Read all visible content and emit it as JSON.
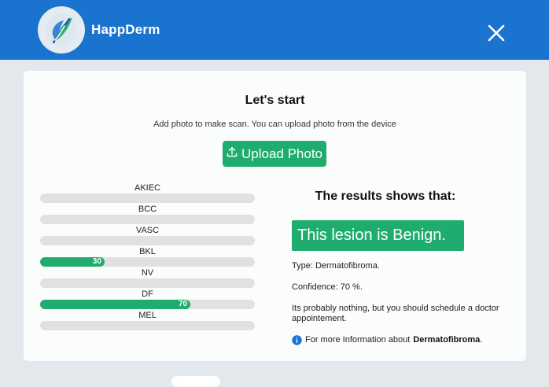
{
  "header": {
    "app_name": "HappDerm",
    "logo_icon": "leaf-logo-icon",
    "close_icon": "close-icon",
    "background": "#1a73cf"
  },
  "main": {
    "title": "Let's start",
    "subtitle": "Add photo to make scan. You can upload photo from the device",
    "upload_label": "Upload Photo",
    "upload_icon": "upload-icon",
    "accent": "#1fad6f"
  },
  "classes": [
    {
      "label": "AKIEC",
      "value": 0,
      "value_label": ""
    },
    {
      "label": "BCC",
      "value": 0,
      "value_label": ""
    },
    {
      "label": "VASC",
      "value": 0,
      "value_label": ""
    },
    {
      "label": "BKL",
      "value": 30,
      "value_label": "30"
    },
    {
      "label": "NV",
      "value": 0,
      "value_label": ""
    },
    {
      "label": "DF",
      "value": 70,
      "value_label": "70"
    },
    {
      "label": "MEL",
      "value": 0,
      "value_label": ""
    }
  ],
  "results": {
    "heading": "The results shows that:",
    "verdict": "This lesion is Benign.",
    "type": "Type: Dermatofibroma.",
    "confidence": "Confidence: 70 %.",
    "advice": "Its probably nothing, but you should schedule a doctor appointement.",
    "more_info_prefix": "For more Information about",
    "more_info_link": "Dermatofibroma",
    "more_info_suffix": ".",
    "info_icon": "info-icon"
  }
}
